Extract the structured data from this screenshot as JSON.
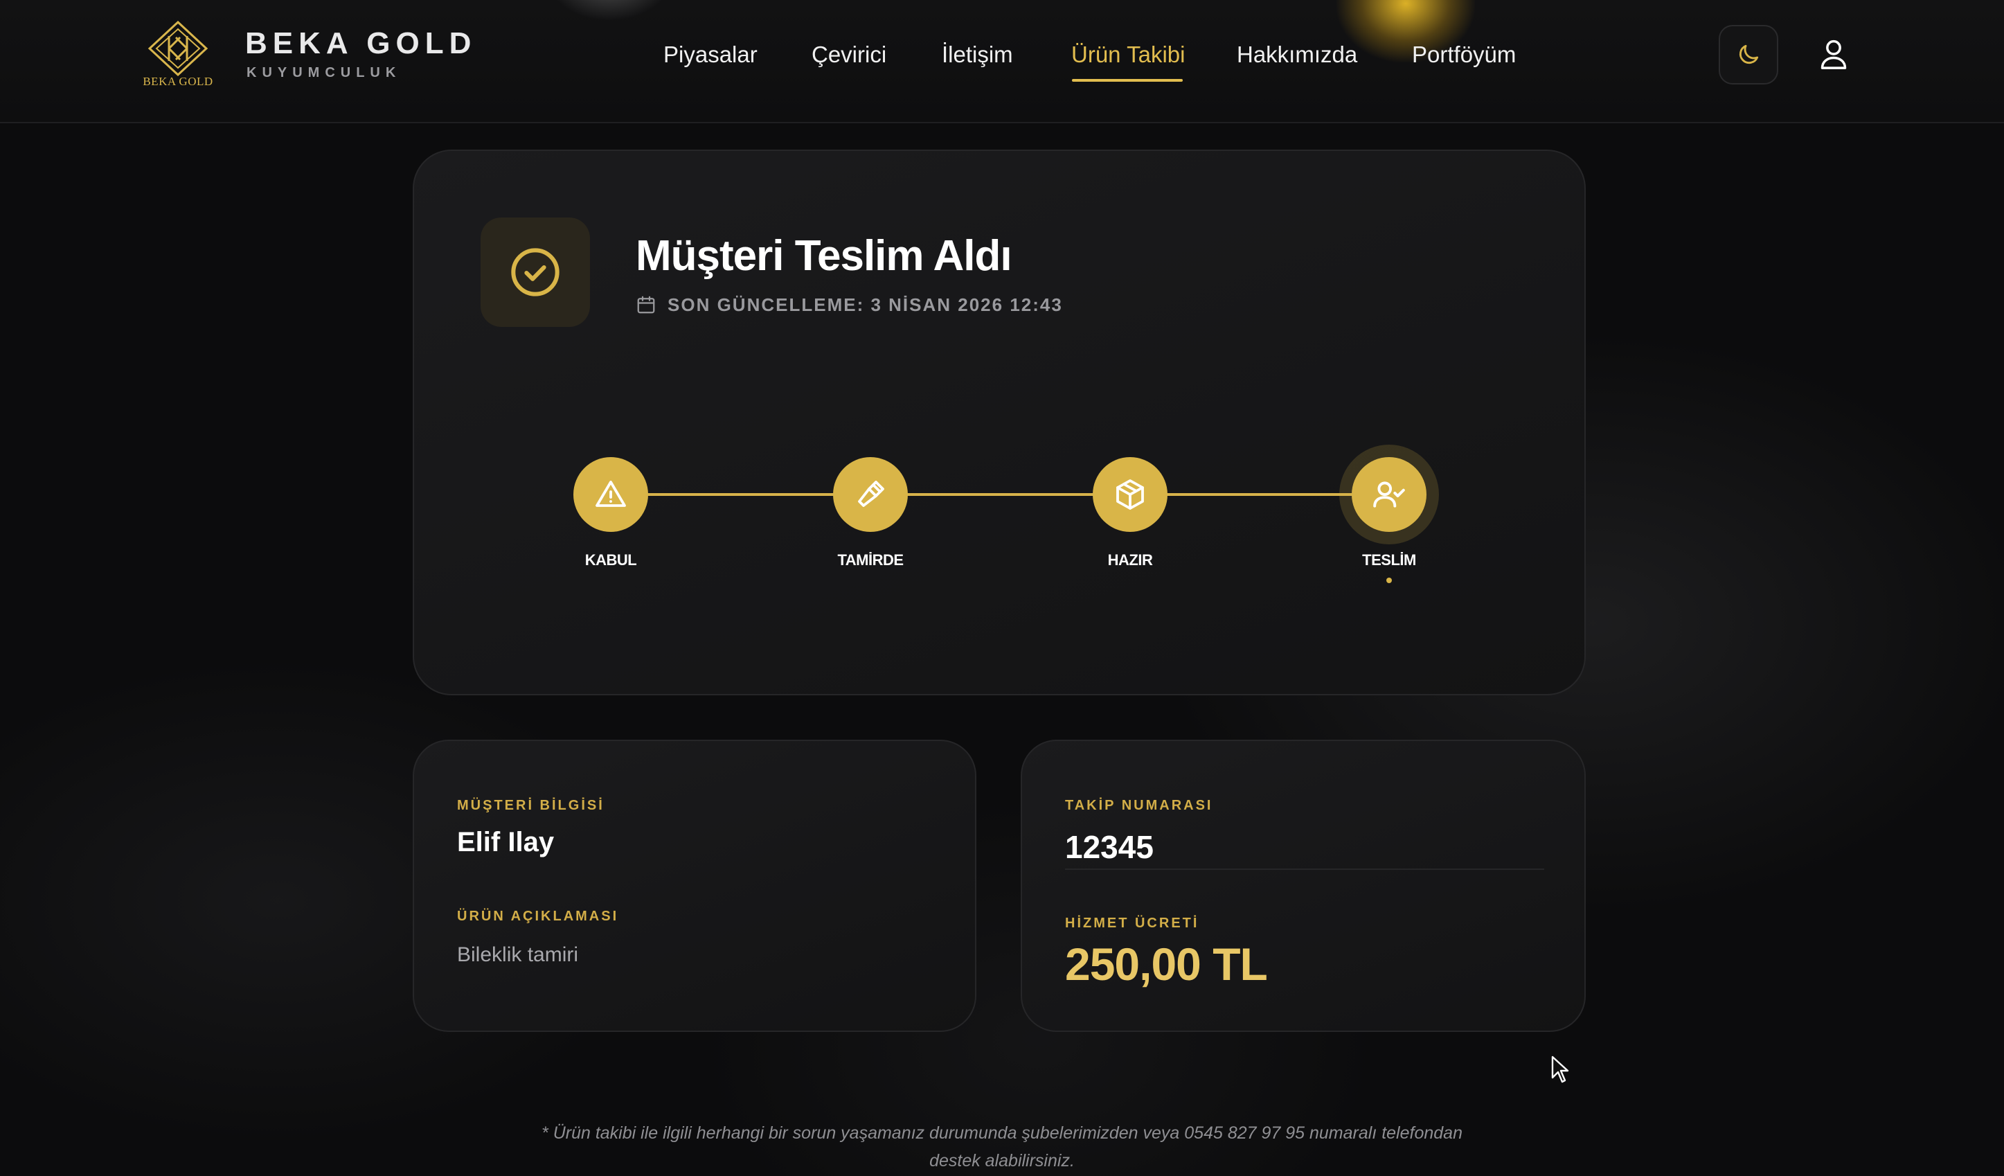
{
  "brand": {
    "name": "BEKA GOLD",
    "tagline": "KUYUMCULUK",
    "logo_subtext": "BEKA GOLD",
    "accent_color": "#d9b548"
  },
  "nav": {
    "items": [
      {
        "label": "Piyasalar",
        "active": false
      },
      {
        "label": "Çevirici",
        "active": false
      },
      {
        "label": "İletişim",
        "active": false
      },
      {
        "label": "Ürün Takibi",
        "active": true
      },
      {
        "label": "Hakkımızda",
        "active": false
      },
      {
        "label": "Portföyüm",
        "active": false
      }
    ],
    "theme_toggle_icon": "moon-icon",
    "user_icon": "user-icon"
  },
  "status": {
    "icon": "check-circle-icon",
    "title": "Müşteri Teslim Aldı",
    "updated_label": "SON GÜNCELLEME: 3 NİSAN 2026 12:43",
    "steps": [
      {
        "label": "KABUL",
        "icon": "warning-triangle-icon"
      },
      {
        "label": "TAMİRDE",
        "icon": "hammer-icon"
      },
      {
        "label": "HAZIR",
        "icon": "package-icon"
      },
      {
        "label": "TESLİM",
        "icon": "user-check-icon",
        "current": true
      }
    ]
  },
  "customer": {
    "label": "MÜŞTERİ BİLGİSİ",
    "name": "Elif Ilay",
    "description_label": "ÜRÜN AÇIKLAMASI",
    "description": "Bileklik tamiri"
  },
  "tracking": {
    "label": "TAKİP NUMARASI",
    "number": "12345",
    "fee_label": "HİZMET ÜCRETİ",
    "fee": "250,00 TL"
  },
  "footer": {
    "line1": "* Ürün takibi ile ilgili herhangi bir sorun yaşamanız durumunda şubelerimizden veya 0545 827 97 95 numaralı telefondan",
    "line2": "destek alabilirsiniz."
  }
}
